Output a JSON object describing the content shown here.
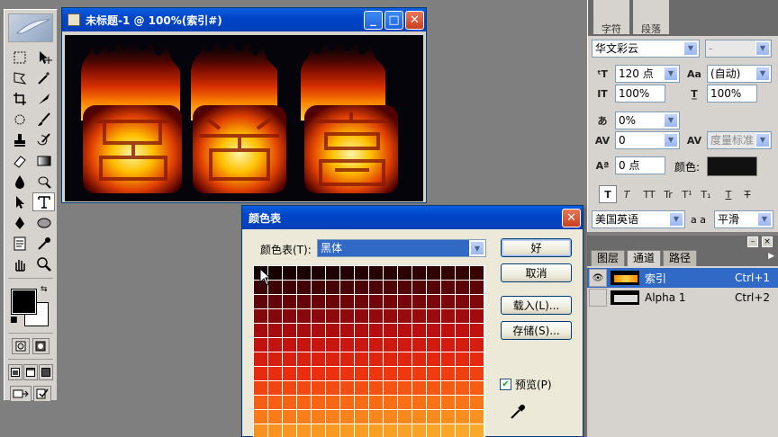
{
  "document": {
    "title": "未标题-1 @ 100%(索引#)",
    "minimize": "_",
    "maximize": "□",
    "close": "✕"
  },
  "character_panel": {
    "tab_char": "字符",
    "tab_para": "段落",
    "font_family": "华文彩云",
    "font_style": "-",
    "font_size": "120 点",
    "leading": "(自动)",
    "vertical_scale": "100%",
    "horizontal_scale": "100%",
    "tsume": "0%",
    "tracking": "0",
    "kerning": "度量标准",
    "baseline_shift": "0 点",
    "color_label": "颜色:",
    "color": "#111111",
    "style_buttons": [
      "T",
      "T",
      "TT",
      "Tr",
      "T¹",
      "T₁",
      "T",
      "T"
    ],
    "language": "美国英语",
    "aa_label": "a a",
    "antialias": "平滑"
  },
  "channels_panel": {
    "tabs": [
      "图层",
      "通道",
      "路径"
    ],
    "channels": [
      {
        "name": "索引",
        "shortcut": "Ctrl+1",
        "selected": true,
        "visible": true
      },
      {
        "name": "Alpha 1",
        "shortcut": "Ctrl+2",
        "selected": false,
        "visible": false
      }
    ]
  },
  "color_table_dialog": {
    "title": "颜色表",
    "table_label": "颜色表(T):",
    "table_value": "黑体",
    "ok": "好",
    "cancel": "取消",
    "load": "载入(L)...",
    "save": "存储(S)...",
    "preview_label": "预览(P)",
    "preview_checked": true,
    "close": "✕"
  },
  "toolbox": {
    "foreground_color": "#000000",
    "background_color": "#ffffff"
  }
}
